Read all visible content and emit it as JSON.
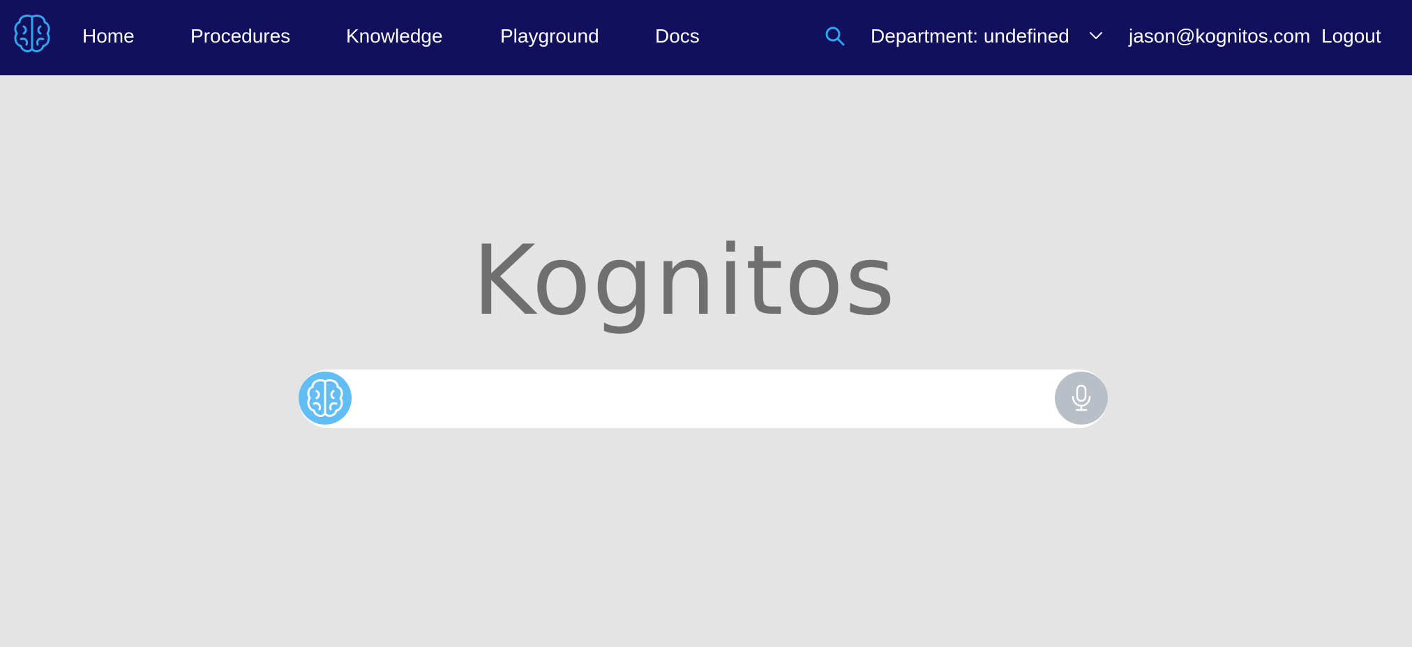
{
  "nav": {
    "items": [
      {
        "label": "Home"
      },
      {
        "label": "Procedures"
      },
      {
        "label": "Knowledge"
      },
      {
        "label": "Playground"
      },
      {
        "label": "Docs"
      }
    ],
    "search_icon": "search-icon",
    "department_label": "Department: undefined",
    "user_email": "jason@kognitos.com",
    "logout_label": "Logout"
  },
  "hero": {
    "title": "Kognitos"
  },
  "search": {
    "value": "",
    "placeholder": "",
    "left_icon": "brain-icon",
    "right_icon": "microphone-icon"
  },
  "colors": {
    "topbar": "#120f5c",
    "background": "#e4e4e4",
    "accent": "#61bdf4",
    "mic_button": "#b9bfc6",
    "title": "#6f6f6f"
  }
}
